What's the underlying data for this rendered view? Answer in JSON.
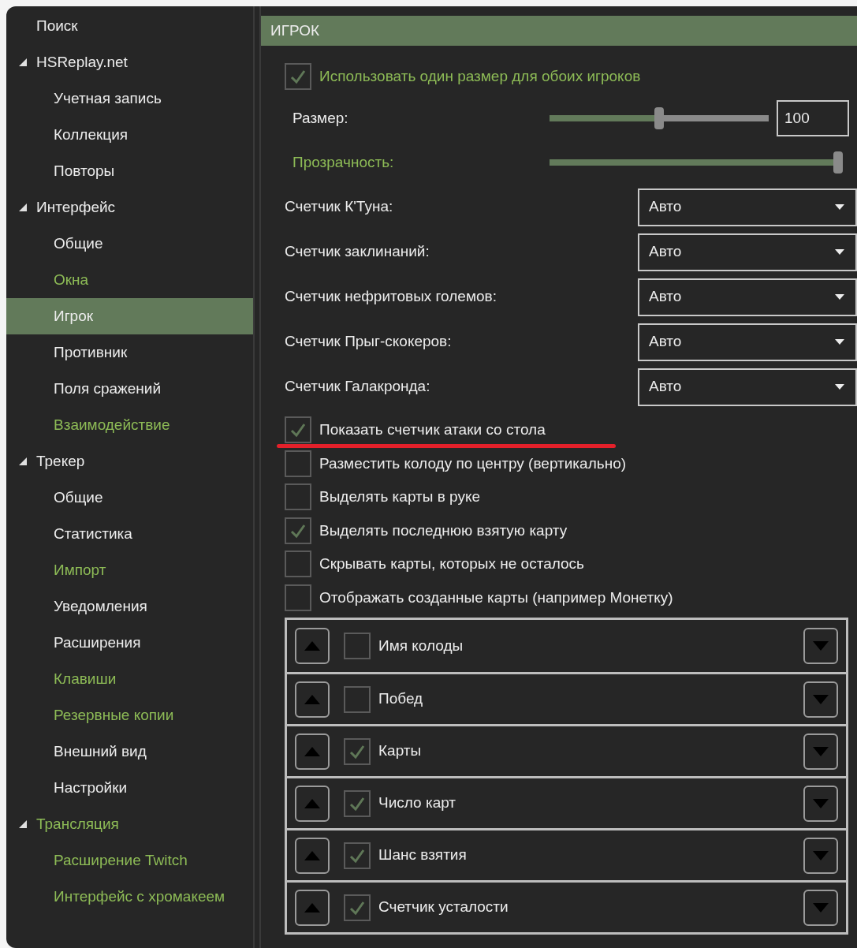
{
  "sidebar": {
    "items": [
      {
        "label": "Поиск",
        "highlighted": false,
        "selected": false
      },
      {
        "label": "HSReplay.net",
        "highlighted": false,
        "selected": false,
        "expanded": true,
        "children": [
          {
            "label": "Учетная запись",
            "highlighted": false,
            "selected": false
          },
          {
            "label": "Коллекция",
            "highlighted": false,
            "selected": false
          },
          {
            "label": "Повторы",
            "highlighted": false,
            "selected": false
          }
        ]
      },
      {
        "label": "Интерфейс",
        "highlighted": false,
        "selected": false,
        "expanded": true,
        "children": [
          {
            "label": "Общие",
            "highlighted": false,
            "selected": false
          },
          {
            "label": "Окна",
            "highlighted": true,
            "selected": false
          },
          {
            "label": "Игрок",
            "highlighted": false,
            "selected": true
          },
          {
            "label": "Противник",
            "highlighted": false,
            "selected": false
          },
          {
            "label": "Поля сражений",
            "highlighted": false,
            "selected": false
          },
          {
            "label": "Взаимодействие",
            "highlighted": true,
            "selected": false
          }
        ]
      },
      {
        "label": "Трекер",
        "highlighted": false,
        "selected": false,
        "expanded": true,
        "children": [
          {
            "label": "Общие",
            "highlighted": false,
            "selected": false
          },
          {
            "label": "Статистика",
            "highlighted": false,
            "selected": false
          },
          {
            "label": "Импорт",
            "highlighted": true,
            "selected": false
          },
          {
            "label": "Уведомления",
            "highlighted": false,
            "selected": false
          },
          {
            "label": "Расширения",
            "highlighted": false,
            "selected": false
          },
          {
            "label": "Клавиши",
            "highlighted": true,
            "selected": false
          },
          {
            "label": "Резервные копии",
            "highlighted": true,
            "selected": false
          },
          {
            "label": "Внешний вид",
            "highlighted": false,
            "selected": false
          },
          {
            "label": "Настройки",
            "highlighted": false,
            "selected": false
          }
        ]
      },
      {
        "label": "Трансляция",
        "highlighted": true,
        "selected": false,
        "expanded": true,
        "children": [
          {
            "label": "Расширение Twitch",
            "highlighted": true,
            "selected": false
          },
          {
            "label": "Интерфейс с хромакеем",
            "highlighted": true,
            "selected": false
          }
        ]
      }
    ]
  },
  "panel": {
    "title": "ИГРОК",
    "same_size": {
      "label": "Использовать один размер для обоих игроков",
      "checked": true,
      "highlighted": true
    },
    "sliders": [
      {
        "label": "Размер:",
        "highlighted": false,
        "level": 0.5,
        "value": "100"
      },
      {
        "label": "Прозрачность:",
        "highlighted": true,
        "level": 1.0
      }
    ],
    "dropdowns": [
      {
        "label": "Счетчик К'Туна:",
        "value": "Авто"
      },
      {
        "label": "Счетчик заклинаний:",
        "value": "Авто"
      },
      {
        "label": "Счетчик нефритовых големов:",
        "value": "Авто"
      },
      {
        "label": "Счетчик Прыг-скокеров:",
        "value": "Авто"
      },
      {
        "label": "Счетчик Галакронда:",
        "value": "Авто"
      }
    ],
    "options": [
      {
        "label": "Показать счетчик атаки со стола",
        "checked": true,
        "underlined": true
      },
      {
        "label": "Разместить колоду по центру (вертикально)",
        "checked": false,
        "underlined": false
      },
      {
        "label": "Выделять карты в руке",
        "checked": false,
        "underlined": false
      },
      {
        "label": "Выделять последнюю взятую карту",
        "checked": true,
        "underlined": false
      },
      {
        "label": "Скрывать карты, которых не осталось",
        "checked": false,
        "underlined": false
      },
      {
        "label": "Отображать созданные карты (например Монетку)",
        "checked": false,
        "underlined": false
      }
    ],
    "panels": [
      {
        "label": "Имя колоды",
        "checked": false
      },
      {
        "label": "Побед",
        "checked": false
      },
      {
        "label": "Карты",
        "checked": true
      },
      {
        "label": "Число карт",
        "checked": true
      },
      {
        "label": "Шанс взятия",
        "checked": true
      },
      {
        "label": "Счетчик усталости",
        "checked": true
      }
    ]
  }
}
